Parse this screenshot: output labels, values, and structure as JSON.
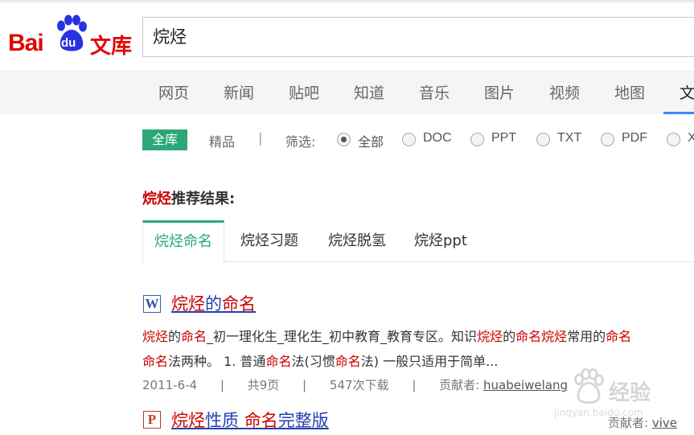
{
  "header": {
    "logo_text": "Bai",
    "logo_du": "du",
    "logo_product": "文库",
    "search_value": "烷烃"
  },
  "nav": {
    "items": [
      "网页",
      "新闻",
      "贴吧",
      "知道",
      "音乐",
      "图片",
      "视频",
      "地图",
      "文"
    ]
  },
  "filter": {
    "tag_all": "全库",
    "tag_premium": "精品",
    "separator": "|",
    "filter_label": "筛选:",
    "options": [
      "全部",
      "DOC",
      "PPT",
      "TXT",
      "PDF",
      "X"
    ],
    "selected": "全部"
  },
  "recommend": {
    "keyword": "烷烃",
    "suffix": "推荐结果:"
  },
  "tabs": [
    "烷烃命名",
    "烷烃习题",
    "烷烃脱氢",
    "烷烃ppt"
  ],
  "results": [
    {
      "type": "word",
      "icon_letter": "W",
      "title_parts": [
        {
          "text": "烷烃",
          "kw": true
        },
        {
          "text": "的",
          "kw": false
        },
        {
          "text": "命名",
          "kw": true
        }
      ],
      "snippet_line1": [
        {
          "text": "烷烃",
          "kw": true
        },
        {
          "text": "的",
          "kw": false
        },
        {
          "text": "命名",
          "kw": true
        },
        {
          "text": "_初一理化生_理化生_初中教育_教育专区。知识",
          "kw": false
        },
        {
          "text": "烷烃",
          "kw": true
        },
        {
          "text": "的",
          "kw": false
        },
        {
          "text": "命名",
          "kw": true
        },
        {
          "text": "烷烃",
          "kw": true
        },
        {
          "text": "常用的",
          "kw": false
        },
        {
          "text": "命名",
          "kw": true
        }
      ],
      "snippet_line2": [
        {
          "text": "命名",
          "kw": true
        },
        {
          "text": "法两种。 1. 普通",
          "kw": false
        },
        {
          "text": "命名",
          "kw": true
        },
        {
          "text": "法(习惯",
          "kw": false
        },
        {
          "text": "命名",
          "kw": true
        },
        {
          "text": "法) 一般只适用于简单...",
          "kw": false
        }
      ],
      "date": "2011-6-4",
      "pages": "共9页",
      "downloads": "547次下载",
      "contributor_label": "贡献者:",
      "contributor": "huabeiwelang"
    },
    {
      "type": "ppt",
      "icon_letter": "P",
      "title_parts": [
        {
          "text": "烷烃",
          "kw": true
        },
        {
          "text": "性质 ",
          "kw": false
        },
        {
          "text": "命名",
          "kw": true
        },
        {
          "text": "完整版",
          "kw": false
        }
      ],
      "contributor_label": "贡献者:",
      "contributor": "vive"
    }
  ],
  "watermark": {
    "text": "经验",
    "sub": "jingyan.baidu.com"
  },
  "colors": {
    "brand_red": "#e10602",
    "accent_green": "#2aa878",
    "link_blue": "#2440b3",
    "keyword_red": "#cc0000"
  }
}
